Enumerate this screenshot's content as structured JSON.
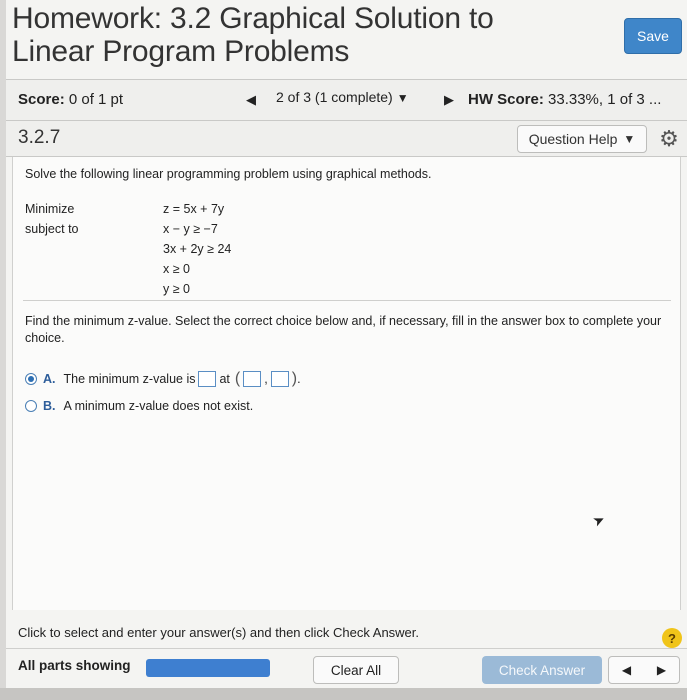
{
  "header": {
    "title_line1": "Homework: 3.2 Graphical Solution to",
    "title_line2": "Linear Program Problems",
    "save_label": "Save"
  },
  "scorebar": {
    "score_label": "Score:",
    "score_value": "0 of 1 pt",
    "nav_label": "2 of 3 (1 complete)",
    "hw_label": "HW Score:",
    "hw_value": "33.33%, 1 of 3 ..."
  },
  "question": {
    "number": "3.2.7",
    "help_label": "Question Help"
  },
  "problem": {
    "instruction": "Solve the following linear programming problem using graphical methods.",
    "minimize_label": "Minimize",
    "subject_label": "subject to",
    "objective": "z = 5x + 7y",
    "constraints": [
      "x − y ≥ −7",
      "3x + 2y ≥ 24",
      "x ≥ 0",
      "y ≥ 0"
    ],
    "prompt": "Find the minimum z-value. Select the correct choice below and, if necessary, fill in the answer box to complete your choice.",
    "choice_a_letter": "A.",
    "choice_a_text": "The minimum z-value is",
    "choice_a_at": "at",
    "choice_b_letter": "B.",
    "choice_b_text": "A minimum z-value does not exist."
  },
  "footer": {
    "instruction": "Click to select and enter your answer(s) and then click Check Answer.",
    "help_symbol": "?",
    "parts_label": "All parts showing",
    "clear_label": "Clear All",
    "check_label": "Check Answer"
  },
  "colors": {
    "save": "#3f86c9",
    "progress": "#3e7fd0",
    "check_disabled": "#9bbad7",
    "help_badge": "#f0c419"
  }
}
